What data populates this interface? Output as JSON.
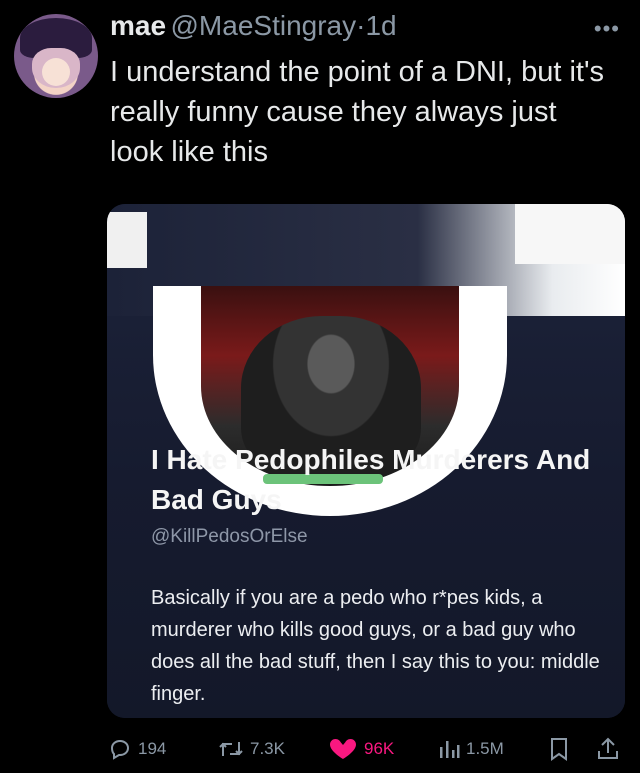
{
  "tweet": {
    "display_name": "mae",
    "handle": "@MaeStingray",
    "separator": "·",
    "age": "1d",
    "more_icon": "ellipsis-icon",
    "text": "I understand the point of a DNI, but it's really funny cause they always just look like this"
  },
  "media": {
    "profile_name": "I Hate Pedophiles Murderers And Bad Guys",
    "profile_handle": "@KillPedosOrElse",
    "profile_bio": "Basically if you are a pedo who r*pes kids, a murderer who kills good guys, or a bad guy who does all the bad stuff, then I say this to you: middle finger."
  },
  "actions": {
    "replies": "194",
    "retweets": "7.3K",
    "likes": "96K",
    "views": "1.5M"
  },
  "colors": {
    "background": "#000000",
    "text": "#e7e9ea",
    "muted": "#8b98a5",
    "like": "#f91880"
  }
}
